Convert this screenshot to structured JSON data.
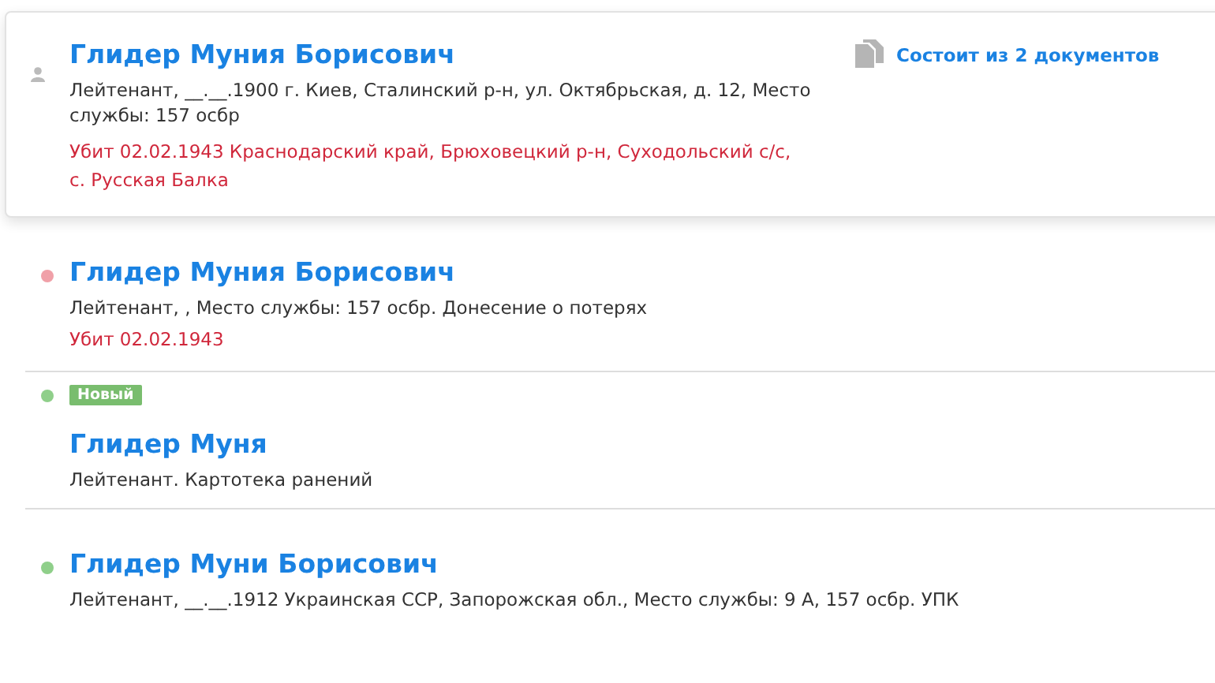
{
  "records": [
    {
      "kind": "card",
      "name": "Глидер Муния Борисович",
      "details": "Лейтенант, __.__.1900 г. Киев, Сталинский р-н, ул. Октябрьская, д. 12, Место службы: 157 осбр",
      "fate": "Убит 02.02.1943 Краснодарский край, Брюховецкий р-н, Суходольский с/с, с. Русская Балка",
      "documents": "Состоит из 2 документов"
    },
    {
      "kind": "dot",
      "color": "#f0a0a8",
      "name": "Глидер Муния Борисович",
      "details": "Лейтенант, , Место службы: 157 осбр. Донесение о потерях",
      "fate": "Убит 02.02.1943"
    },
    {
      "kind": "dot",
      "color": "#8fcf8a",
      "badge": "Новый",
      "name": "Глидер Муня",
      "details": "Лейтенант. Картотека ранений"
    },
    {
      "kind": "dot",
      "color": "#8fcf8a",
      "name": "Глидер Муни Борисович",
      "details": "Лейтенант, __.__.1912 Украинская ССР, Запорожская обл., Место службы: 9 А, 157 осбр. УПК"
    }
  ]
}
